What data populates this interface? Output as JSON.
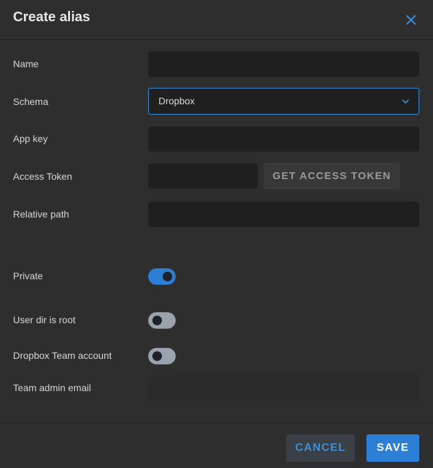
{
  "dialog": {
    "title": "Create alias"
  },
  "form": {
    "name": {
      "label": "Name",
      "value": ""
    },
    "schema": {
      "label": "Schema",
      "value": "Dropbox"
    },
    "app_key": {
      "label": "App key",
      "value": ""
    },
    "access_token": {
      "label": "Access Token",
      "value": "",
      "button_label": "GET ACCESS TOKEN"
    },
    "relative_path": {
      "label": "Relative path",
      "value": ""
    },
    "private": {
      "label": "Private",
      "checked": true
    },
    "user_dir_is_root": {
      "label": "User dir is root",
      "checked": false
    },
    "dropbox_team_account": {
      "label": "Dropbox Team account",
      "checked": false
    },
    "team_admin_email": {
      "label": "Team admin email",
      "value": ""
    }
  },
  "footer": {
    "cancel_label": "CANCEL",
    "save_label": "SAVE"
  },
  "colors": {
    "accent": "#2d7fd6",
    "background": "#2e2e2e",
    "field": "#1f1f1f"
  },
  "icons": {
    "close": "close-icon",
    "chevron": "chevron-down-icon"
  }
}
